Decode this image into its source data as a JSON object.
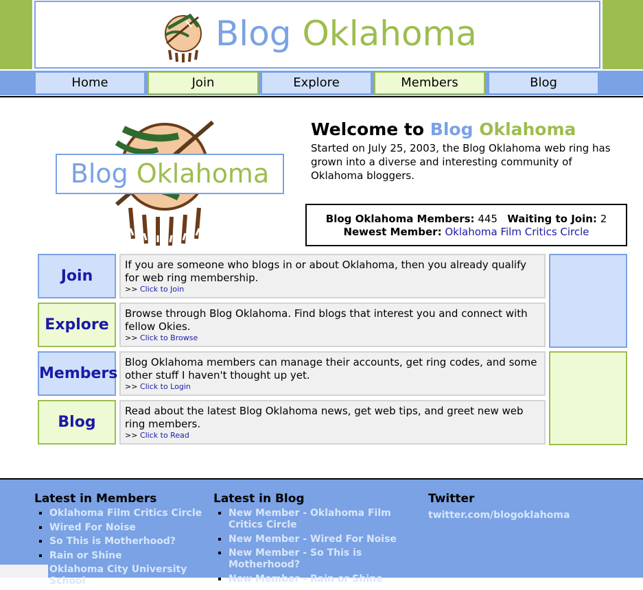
{
  "header": {
    "title_part1": "Blog",
    "title_part2": "Oklahoma",
    "seal_icon": "oklahoma-seal-icon"
  },
  "nav": {
    "items": [
      {
        "label": "Home"
      },
      {
        "label": "Join"
      },
      {
        "label": "Explore"
      },
      {
        "label": "Members"
      },
      {
        "label": "Blog"
      }
    ]
  },
  "hero": {
    "logo_part1": "Blog",
    "logo_part2": "Oklahoma",
    "welcome_prefix": "Welcome to",
    "welcome_part1": "Blog",
    "welcome_part2": "Oklahoma",
    "intro": "Started on July 25, 2003, the Blog Oklahoma web ring has grown into a diverse and interesting community of Oklahoma bloggers."
  },
  "stats": {
    "members_label": "Blog Oklahoma Members:",
    "members_count": "445",
    "waiting_label": "Waiting to Join:",
    "waiting_count": "2",
    "newest_label": "Newest Member:",
    "newest_name": "Oklahoma Film Critics Circle"
  },
  "features": [
    {
      "label": "Join",
      "text": "If you are someone who blogs in or about Oklahoma, then you already qualify for web ring membership.",
      "link_prefix": ">>",
      "link": "Click to Join"
    },
    {
      "label": "Explore",
      "text": "Browse through Blog Oklahoma. Find blogs that interest you and connect with fellow Okies.",
      "link_prefix": ">>",
      "link": "Click to Browse"
    },
    {
      "label": "Members",
      "text": "Blog Oklahoma members can manage their accounts, get ring codes, and some other stuff I haven't thought up yet.",
      "link_prefix": ">>",
      "link": "Click to Login"
    },
    {
      "label": "Blog",
      "text": "Read about the latest Blog Oklahoma news, get web tips, and greet new web ring members.",
      "link_prefix": ">>",
      "link": "Click to Read"
    }
  ],
  "footer": {
    "members": {
      "title": "Latest in Members",
      "items": [
        "Oklahoma Film Critics Circle",
        "Wired For Noise",
        "So This is Motherhood?",
        "Rain or Shine",
        "Oklahoma City University School"
      ]
    },
    "blog": {
      "title": "Latest in Blog",
      "items": [
        "New Member - Oklahoma Film Critics Circle",
        "New Member - Wired For Noise",
        "New Member - So This is Motherhood?",
        "New Member - Rain or Shine"
      ]
    },
    "twitter": {
      "title": "Twitter",
      "link": "twitter.com/blogoklahoma"
    }
  },
  "colors": {
    "blue": "#7aa2e4",
    "green": "#9dbd4f",
    "light_blue": "#d0e0fa",
    "light_green": "#eefad4",
    "link": "#1a1aa6"
  }
}
